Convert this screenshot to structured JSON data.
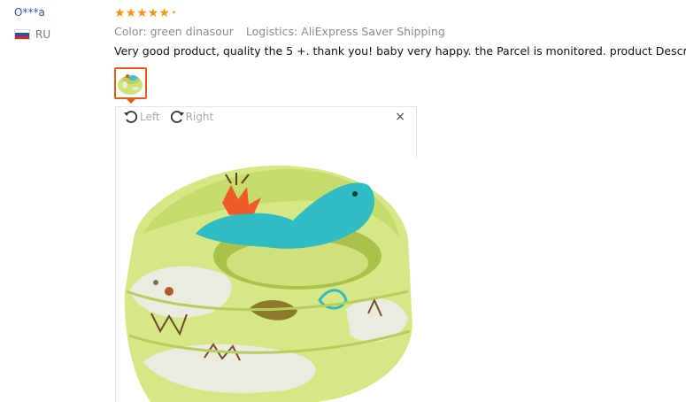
{
  "reviewer": {
    "name": "O***a",
    "country": "RU"
  },
  "review": {
    "rating": 5,
    "stars": [
      "★",
      "★",
      "★",
      "★",
      "★"
    ],
    "color": "Color: green dinasour",
    "logistics": "Logistics: AliExpress Saver Shipping",
    "text": "Very good product, quality the 5 +. thank you! baby very happy. the Parcel is monitored. product Description"
  },
  "viewer": {
    "rotate_left_label": "Left",
    "rotate_right_label": "Right",
    "close_label": "×"
  },
  "colors": {
    "accent": "#f29413",
    "thumb_border": "#e65c10",
    "link": "#2a5db0"
  }
}
